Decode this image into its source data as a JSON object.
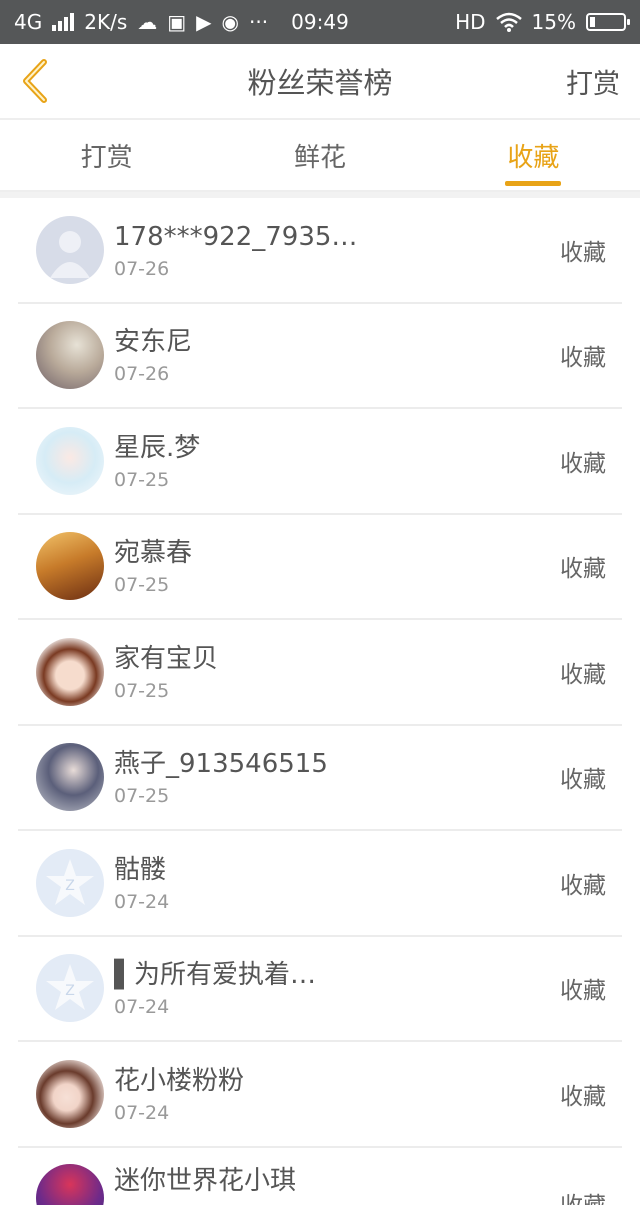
{
  "status": {
    "network": "4G",
    "speed": "2K/s",
    "time": "09:49",
    "hd": "HD",
    "battery": "15%",
    "battery_level": 0.15,
    "more": "···"
  },
  "header": {
    "title": "粉丝荣誉榜",
    "right_label": "打赏"
  },
  "tabs": [
    {
      "label": "打赏",
      "active": false
    },
    {
      "label": "鲜花",
      "active": false
    },
    {
      "label": "收藏",
      "active": true
    }
  ],
  "fans": [
    {
      "name": "178***922_7935…",
      "date": "07-26",
      "action": "收藏",
      "avatar": "default-person-avatar"
    },
    {
      "name": "安东尼",
      "date": "07-26",
      "action": "收藏",
      "avatar": "photo-avatar"
    },
    {
      "name": "星辰.梦",
      "date": "07-25",
      "action": "收藏",
      "avatar": "anime-girl-avatar"
    },
    {
      "name": "宛慕春",
      "date": "07-25",
      "action": "收藏",
      "avatar": "photo-avatar"
    },
    {
      "name": "家有宝贝",
      "date": "07-25",
      "action": "收藏",
      "avatar": "anime-girl-avatar"
    },
    {
      "name": "燕子_913546515",
      "date": "07-25",
      "action": "收藏",
      "avatar": "anime-boy-avatar"
    },
    {
      "name": "骷髅",
      "date": "07-24",
      "action": "收藏",
      "avatar": "qq-star-avatar"
    },
    {
      "name": "▌为所有爱执着…",
      "date": "07-24",
      "action": "收藏",
      "avatar": "qq-star-avatar"
    },
    {
      "name": "花小楼粉粉",
      "date": "07-24",
      "action": "收藏",
      "avatar": "anime-girl-avatar"
    },
    {
      "name": "迷你世界花小琪",
      "date": "",
      "action": "收藏",
      "avatar": "cartoon-avatar"
    }
  ],
  "colors": {
    "accent": "#e8a317",
    "statusbar": "#555758"
  }
}
